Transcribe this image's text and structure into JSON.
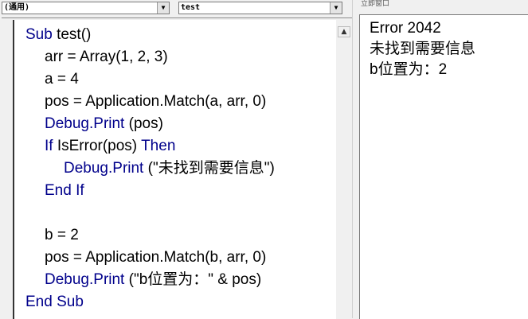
{
  "header": {
    "object_dropdown": "(通用)",
    "procedure_dropdown": "test",
    "dropdown_arrow": "▼"
  },
  "code": {
    "lines": [
      {
        "indent": 0,
        "segments": [
          {
            "t": "Sub",
            "kw": true
          },
          {
            "t": " test()"
          }
        ]
      },
      {
        "indent": 1,
        "segments": [
          {
            "t": "arr = Array(1, 2, 3)"
          }
        ]
      },
      {
        "indent": 1,
        "segments": [
          {
            "t": "a = 4"
          }
        ]
      },
      {
        "indent": 1,
        "segments": [
          {
            "t": "pos = Application.Match(a, arr, 0)"
          }
        ]
      },
      {
        "indent": 1,
        "segments": [
          {
            "t": "Debug.Print",
            "kw": true
          },
          {
            "t": " (pos)"
          }
        ]
      },
      {
        "indent": 1,
        "segments": [
          {
            "t": "If",
            "kw": true
          },
          {
            "t": " IsError(pos) "
          },
          {
            "t": "Then",
            "kw": true
          }
        ]
      },
      {
        "indent": 2,
        "segments": [
          {
            "t": "Debug.Print",
            "kw": true
          },
          {
            "t": " (\"未找到需要信息\")"
          }
        ]
      },
      {
        "indent": 1,
        "segments": [
          {
            "t": "End If",
            "kw": true
          }
        ]
      },
      {
        "indent": 0,
        "segments": []
      },
      {
        "indent": 1,
        "segments": [
          {
            "t": "b = 2"
          }
        ]
      },
      {
        "indent": 1,
        "segments": [
          {
            "t": "pos = Application.Match(b, arr, 0)"
          }
        ]
      },
      {
        "indent": 1,
        "segments": [
          {
            "t": "Debug.Print",
            "kw": true
          },
          {
            "t": " (\"b位置为：\" & pos)"
          }
        ]
      },
      {
        "indent": 0,
        "segments": [
          {
            "t": "End Sub",
            "kw": true
          }
        ]
      }
    ],
    "keyword_color": "#00008b"
  },
  "immediate": {
    "title": "立即窗口",
    "lines": [
      "Error 2042",
      "未找到需要信息",
      "b位置为：2"
    ]
  },
  "scrollbar": {
    "up_arrow": "▲"
  }
}
